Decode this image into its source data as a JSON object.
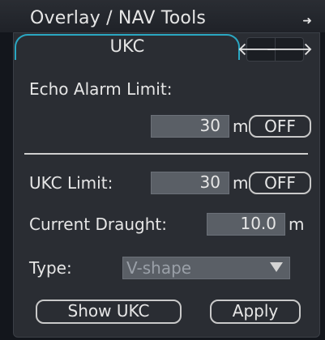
{
  "window": {
    "title": "Overlay / NAV Tools",
    "title_arrow": "➜"
  },
  "tabs": {
    "active_label": "UKC",
    "nav_left": "🡐",
    "nav_right": "🡒"
  },
  "echo_alarm": {
    "label": "Echo Alarm Limit:",
    "value": "30",
    "unit": "m",
    "toggle_label": "OFF"
  },
  "ukc_limit": {
    "label": "UKC Limit:",
    "value": "30",
    "unit": "m",
    "toggle_label": "OFF"
  },
  "draught": {
    "label": "Current Draught:",
    "value": "10.0",
    "unit": "m"
  },
  "type": {
    "label": "Type:",
    "selected": "V-shape"
  },
  "actions": {
    "show_ukc": "Show UKC",
    "apply": "Apply"
  }
}
